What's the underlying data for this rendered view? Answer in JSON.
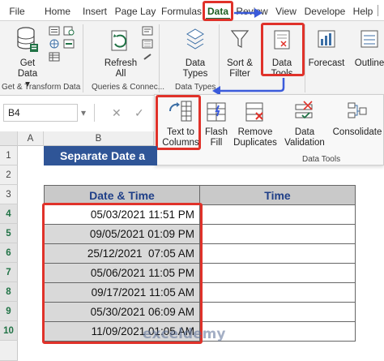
{
  "tabs": [
    "File",
    "Home",
    "Insert",
    "Page Lay",
    "Formulas",
    "Data",
    "Review",
    "View",
    "Develope",
    "Help"
  ],
  "ribbon": {
    "get_data": "Get Data",
    "get_data_arrow": "▾",
    "refresh_all": "Refresh All",
    "data_types": "Data Types",
    "sort_filter": "Sort & Filter",
    "data_tools": "Data Tools",
    "forecast": "Forecast",
    "outline": "Outline",
    "groups": {
      "get_transform": "Get & Transform Data",
      "queries": "Queries & Connec...",
      "data_types": "Data Types"
    }
  },
  "popup": {
    "text_to_columns": "Text to Columns",
    "flash_fill": "Flash Fill",
    "remove_duplicates": "Remove Duplicates",
    "data_validation": "Data Validation",
    "consolidate": "Consolidate",
    "group_label": "Data Tools"
  },
  "formula_bar": {
    "name_box": "B4",
    "cancel": "✕",
    "enter": "✓"
  },
  "sheet": {
    "columns": [
      "A",
      "B"
    ],
    "rows": [
      "1",
      "2",
      "3",
      "4",
      "5",
      "6",
      "7",
      "8",
      "9",
      "10"
    ],
    "title": "Separate Date a",
    "headers": {
      "date_time": "Date & Time",
      "time": "Time"
    },
    "datetimes": [
      "05/03/2021 11:51 PM",
      "09/05/2021 01:09 PM",
      "25/12/2021  07:05 AM",
      "05/06/2021 11:05 PM",
      "09/17/2021 11:05 AM",
      "05/30/2021 06:09 AM",
      "11/09/2021 01:05 AM"
    ]
  },
  "watermark": "exceldemy",
  "colors": {
    "accent": "#217346",
    "highlight": "#e0322a",
    "arrow": "#3b5bdb",
    "title_bg": "#2f5597"
  }
}
